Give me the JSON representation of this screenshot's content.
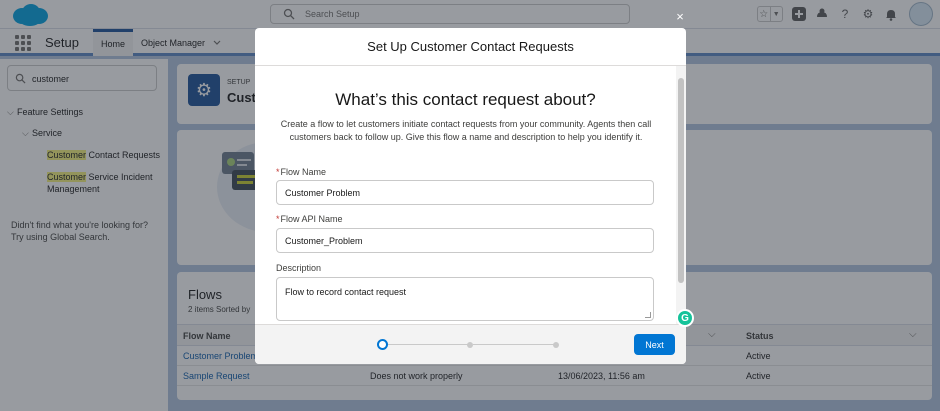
{
  "header": {
    "search_placeholder": "Search Setup",
    "icons": [
      "favorites-star-icon",
      "favorites-dropdown-icon",
      "global-add-icon",
      "trailhead-icon",
      "help-icon",
      "settings-gear-icon",
      "notifications-bell-icon",
      "user-avatar"
    ]
  },
  "nav": {
    "app_name": "Setup",
    "tabs": [
      {
        "label": "Home",
        "active": true
      },
      {
        "label": "Object Manager",
        "active": false
      }
    ]
  },
  "sidebar": {
    "search_value": "customer",
    "tree": {
      "root": "Feature Settings",
      "child": "Service",
      "items": [
        {
          "highlight": "Customer",
          "rest": " Contact Requests"
        },
        {
          "highlight": "Customer",
          "rest": " Service Incident",
          "line2": "Management"
        }
      ]
    },
    "help_line1": "Didn't find what you're looking for?",
    "help_line2": "Try using Global Search."
  },
  "page": {
    "setup_label": "SETUP",
    "title_fragment": "Cust"
  },
  "flows": {
    "title": "Flows",
    "subtitle": "2 items Sorted by",
    "columns": [
      "Flow Name",
      "Status"
    ],
    "rows": [
      {
        "name": "Customer Problem",
        "description": "",
        "date": "",
        "status": "Active"
      },
      {
        "name": "Sample Request",
        "description": "Does not work properly",
        "date": "13/06/2023, 11:56 am",
        "status": "Active"
      }
    ]
  },
  "modal": {
    "header": "Set Up Customer Contact Requests",
    "title": "What’s this contact request about?",
    "description": "Create a flow to let customers initiate contact requests from your community. Agents then call customers back to follow up. Give this flow a name and description to help you identify it.",
    "fields": {
      "flow_name_label": "Flow Name",
      "flow_name_value": "Customer Problem",
      "api_name_label": "Flow API Name",
      "api_name_value": "Customer_Problem",
      "description_label": "Description",
      "description_value": "Flow to record contact request"
    },
    "required_mark": "*",
    "progress": {
      "current_step": 1,
      "total_steps": 3
    },
    "next_label": "Next",
    "close_glyph": "×"
  },
  "colors": {
    "brand_blue": "#0176d3",
    "nav_accent": "#1b5297",
    "highlight": "#f5f27b",
    "grammarly": "#15c39a"
  }
}
